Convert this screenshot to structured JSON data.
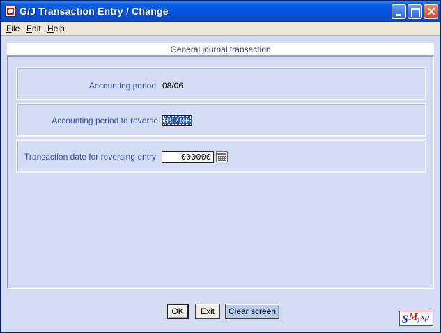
{
  "window": {
    "title": "G/J Transaction Entry / Change"
  },
  "menu": {
    "items": [
      {
        "label": "File",
        "underline": "F",
        "rest": "ile"
      },
      {
        "label": "Edit",
        "underline": "E",
        "rest": "dit"
      },
      {
        "label": "Help",
        "underline": "H",
        "rest": "elp"
      }
    ]
  },
  "header": {
    "title": "General journal transaction"
  },
  "form": {
    "accounting_period_label": "Accounting period",
    "accounting_period_value": "08/06",
    "reverse_period_label": "Accounting period to reverse",
    "reverse_period_value": "09/06",
    "reversing_date_label": "Transaction  date for reversing entry",
    "reversing_date_value": "000000"
  },
  "buttons": {
    "ok": "OK",
    "exit": "Exit",
    "clear": "Clear screen"
  },
  "logo": {
    "s": "S",
    "m": "M",
    "two": "2",
    "xp": "xp"
  },
  "colors": {
    "window_bg": "#d4dcf4",
    "label": "#2c52a8",
    "title_bar": "#0054e3",
    "selection": "#2b5aa8"
  },
  "icons": [
    "app-icon",
    "minimize-icon",
    "maximize-icon",
    "close-icon",
    "calendar-icon"
  ]
}
